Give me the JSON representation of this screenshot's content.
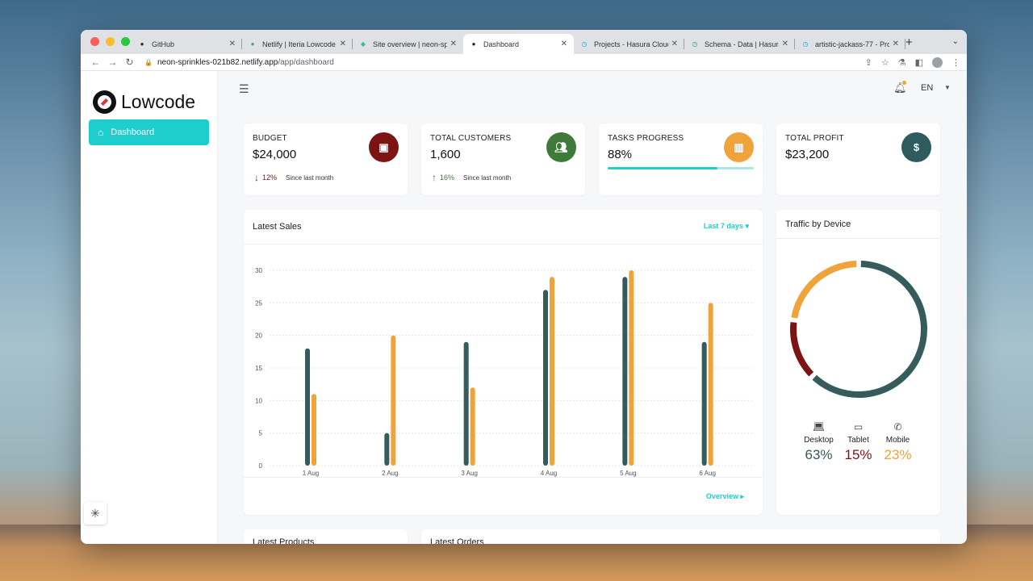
{
  "browser": {
    "tabs": [
      {
        "label": "GitHub",
        "active": false
      },
      {
        "label": "Netlify | Iteria Lowcode",
        "active": false
      },
      {
        "label": "Site overview | neon-spri",
        "active": false
      },
      {
        "label": "Dashboard",
        "active": true
      },
      {
        "label": "Projects - Hasura Cloud",
        "active": false
      },
      {
        "label": "Schema - Data | Hasura",
        "active": false
      },
      {
        "label": "artistic-jackass-77 - Pro",
        "active": false
      }
    ],
    "url_host": "neon-sprinkles-021b82.netlify.app",
    "url_path": "/app/dashboard"
  },
  "sidebar": {
    "logo_text": "Lowcode",
    "items": [
      {
        "label": "Dashboard",
        "icon": "home-icon",
        "active": true
      }
    ]
  },
  "header": {
    "language": "EN"
  },
  "stats": {
    "budget": {
      "label": "BUDGET",
      "value": "$24,000",
      "change": "12%",
      "direction": "down",
      "since": "Since last month",
      "color": "#7d1414"
    },
    "customers": {
      "label": "TOTAL CUSTOMERS",
      "value": "1,600",
      "change": "16%",
      "direction": "up",
      "since": "Since last month",
      "color": "#3f7a3a"
    },
    "tasks": {
      "label": "TASKS PROGRESS",
      "value": "88%",
      "progress": 0.75,
      "color": "#f0a33a"
    },
    "profit": {
      "label": "TOTAL PROFIT",
      "value": "$23,200",
      "color": "#2f5b5e"
    }
  },
  "sales": {
    "title": "Latest Sales",
    "range": "Last 7 days",
    "overview": "Overview"
  },
  "chart_data": {
    "type": "bar",
    "categories": [
      "1 Aug",
      "2 Aug",
      "3 Aug",
      "4 Aug",
      "5 Aug",
      "6 Aug"
    ],
    "series": [
      {
        "name": "",
        "color": "#355b5c",
        "values": [
          18,
          5,
          19,
          27,
          29,
          19
        ]
      },
      {
        "name": "",
        "color": "#f0a33a",
        "values": [
          11,
          20,
          12,
          29,
          30,
          25
        ]
      }
    ],
    "ylim": [
      0,
      30
    ],
    "yticks": [
      0,
      5,
      10,
      15,
      20,
      25,
      30
    ],
    "grid": true
  },
  "traffic": {
    "title": "Traffic by Device",
    "devices": [
      {
        "name": "Desktop",
        "value": "63%",
        "percent": 63,
        "color": "#355b5c",
        "icon": "laptop-icon"
      },
      {
        "name": "Tablet",
        "value": "15%",
        "percent": 15,
        "color": "#7d1414",
        "icon": "tablet-icon"
      },
      {
        "name": "Mobile",
        "value": "23%",
        "percent": 23,
        "color": "#f0a33a",
        "icon": "phone-icon"
      }
    ]
  },
  "bottom": {
    "products_title": "Latest Products",
    "orders_title": "Latest Orders"
  }
}
